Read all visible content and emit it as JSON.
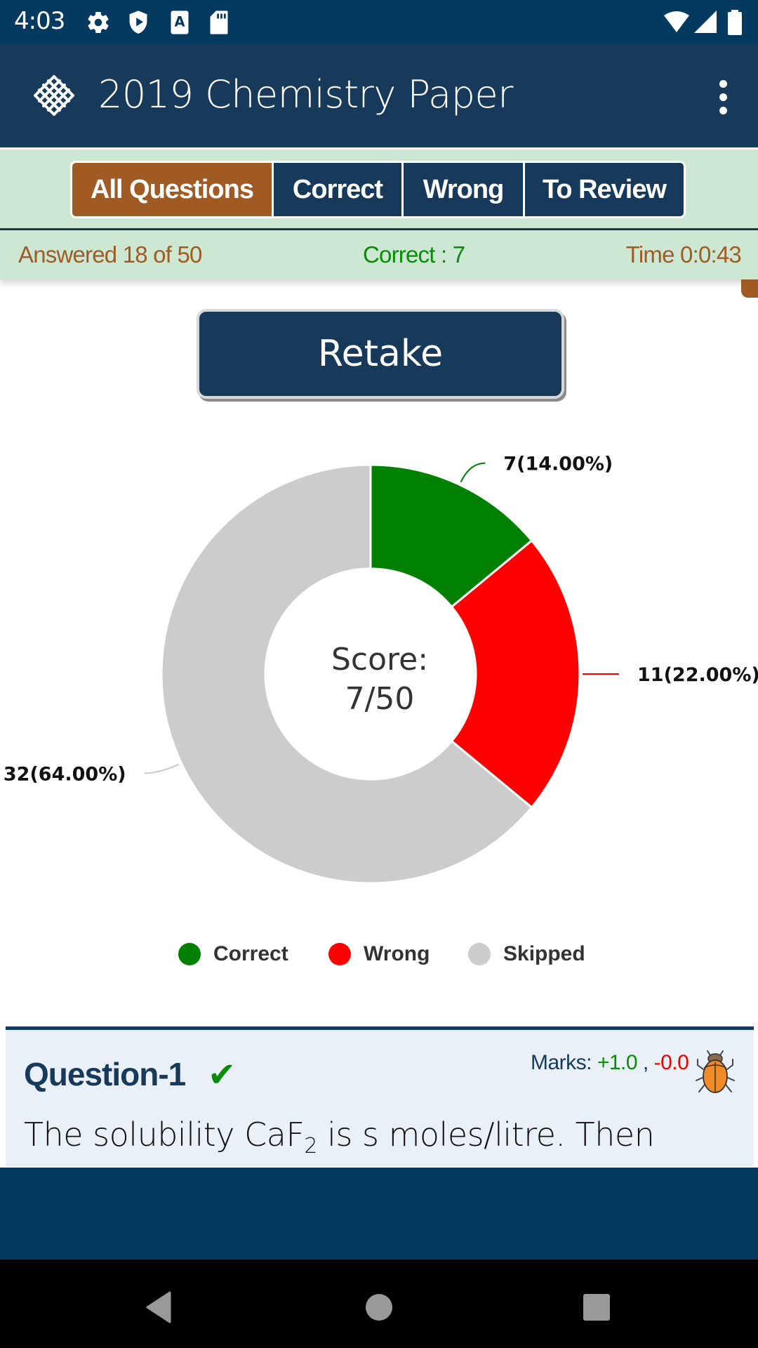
{
  "status_bar": {
    "time": "4:03",
    "left_icons": [
      "gear-icon",
      "shield-play-icon",
      "font-a-icon",
      "sd-card-icon"
    ],
    "right_icons": [
      "wifi-icon",
      "cell-signal-icon",
      "battery-icon"
    ]
  },
  "app_bar": {
    "title": "2019 Chemistry Paper",
    "logo": "crosshatch-diamond-logo",
    "menu_icon": "overflow-menu-icon"
  },
  "filter_tabs": [
    {
      "label": "All Questions",
      "active": true
    },
    {
      "label": "Correct",
      "active": false
    },
    {
      "label": "Wrong",
      "active": false
    },
    {
      "label": "To Review",
      "active": false
    }
  ],
  "stats": {
    "answered": "Answered 18 of 50",
    "correct": "Correct : 7",
    "time": "Time 0:0:43"
  },
  "retake_label": "Retake",
  "chart_data": {
    "type": "pie",
    "variant": "donut",
    "categories": [
      "Correct",
      "Wrong",
      "Skipped"
    ],
    "values": [
      7,
      11,
      32
    ],
    "percentages": [
      14.0,
      22.0,
      64.0
    ],
    "labels": [
      "7(14.00%)",
      "11(22.00%)",
      "32(64.00%)"
    ],
    "colors": [
      "#008000",
      "#ff0000",
      "#cccccc"
    ],
    "center_text": [
      "Score:",
      "7/50"
    ],
    "start_angle": "12 o'clock, clockwise",
    "legend": {
      "position": "bottom",
      "entries": [
        {
          "label": "Correct",
          "color": "#008000"
        },
        {
          "label": "Wrong",
          "color": "#ff0000"
        },
        {
          "label": "Skipped",
          "color": "#cccccc"
        }
      ]
    }
  },
  "question": {
    "title": "Question-1",
    "status_icon": "checkmark-icon",
    "marks_label": "Marks:",
    "marks_plus": "+1.0",
    "marks_sep": ",",
    "marks_minus": "-0.0",
    "report_icon": "bug-icon",
    "text_before": "The solubility CaF",
    "text_sub": "2",
    "text_after": " is s moles/litre. Then"
  },
  "colors": {
    "primary": "#183a5a",
    "status_bar": "#043a60",
    "accent": "#a05a24",
    "filter_bg": "#cce8d2",
    "correct": "#008000",
    "wrong": "#ff0000",
    "skipped": "#cccccc"
  },
  "nav_bar": [
    "back-icon",
    "home-icon",
    "recents-icon"
  ]
}
